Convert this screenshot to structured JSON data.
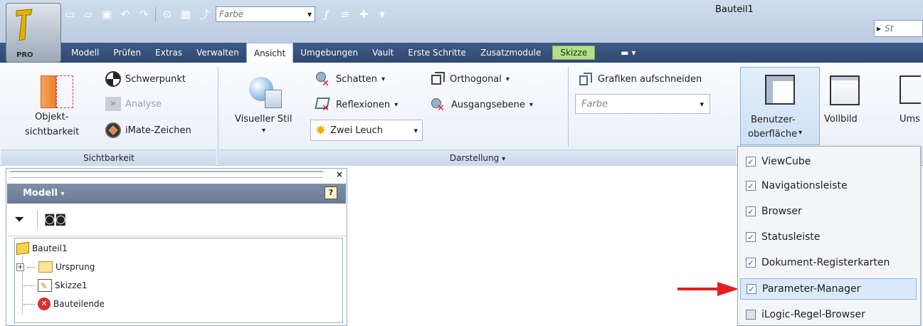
{
  "window": {
    "title": "Bauteil1",
    "search_placeholder": "St"
  },
  "app_button": {
    "badge": "PRO"
  },
  "quick_access": {
    "color_combo": "Farbe",
    "icons": [
      "new-icon",
      "open-icon",
      "save-icon",
      "undo-icon",
      "redo-icon",
      "select-icon",
      "measure-icon",
      "return-icon",
      "fx-icon",
      "thickness-icon",
      "color-icon",
      "customize-icon"
    ]
  },
  "tabs": [
    {
      "label": "Modell"
    },
    {
      "label": "Prüfen"
    },
    {
      "label": "Extras"
    },
    {
      "label": "Verwalten"
    },
    {
      "label": "Ansicht"
    },
    {
      "label": "Umgebungen"
    },
    {
      "label": "Vault"
    },
    {
      "label": "Erste Schritte"
    },
    {
      "label": "Zusatzmodule"
    },
    {
      "label": "Skizze"
    }
  ],
  "ribbon": {
    "sichtbarkeit": {
      "panel_label": "Sichtbarkeit",
      "objekt_line1": "Objekt-",
      "objekt_line2": "sichtbarkeit",
      "schwerpunkt": "Schwerpunkt",
      "analyse": "Analyse",
      "imate": "iMate-Zeichen"
    },
    "darstellung": {
      "panel_label": "Darstellung",
      "visueller_stil": "Visueller Stil",
      "schatten": "Schatten",
      "reflexionen": "Reflexionen",
      "zwei_leuchten": "Zwei Leuch",
      "orthogonal": "Orthogonal",
      "ausgangsebene": "Ausgangsebene",
      "grafiken_aufschneiden": "Grafiken aufschneiden",
      "farbe": "Farbe"
    },
    "fenster": {
      "benutzer_line1": "Benutzer-",
      "benutzer_line2": "oberfläche",
      "vollbild": "Vollbild",
      "umschalten": "Ums"
    }
  },
  "browser": {
    "header": "Modell",
    "help_label": "?",
    "tree": [
      {
        "label": "Bauteil1"
      },
      {
        "label": "Ursprung"
      },
      {
        "label": "Skizze1"
      },
      {
        "label": "Bauteilende"
      }
    ]
  },
  "ui_menu": {
    "items": [
      {
        "label": "ViewCube",
        "checked": true
      },
      {
        "label": "Navigationsleiste",
        "checked": true
      },
      {
        "label": "Browser",
        "checked": true
      },
      {
        "label": "Statusleiste",
        "checked": true
      },
      {
        "label": "Dokument-Registerkarten",
        "checked": true
      },
      {
        "label": "Parameter-Manager",
        "checked": true
      },
      {
        "label": "iLogic-Regel-Browser",
        "checked": false
      }
    ]
  },
  "colors": {
    "title_bar": "#bccde3",
    "tab_bar": "#2e4873",
    "context_tab": "#b7dd8a",
    "arrow": "#e02020"
  }
}
